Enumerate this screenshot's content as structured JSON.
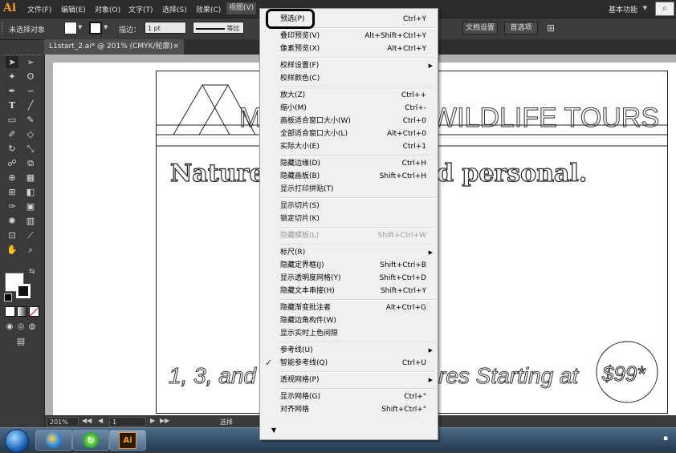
{
  "app": {
    "logo": "Ai",
    "menus": [
      "文件(F)",
      "编辑(E)",
      "对象(O)",
      "文字(T)",
      "选择(S)",
      "效果(C)",
      "视图(V)"
    ],
    "active_menu": "视图(V)",
    "workspace": "基本功能",
    "search_icon": "search-icon"
  },
  "control_bar": {
    "selection_status": "未选择对象",
    "stroke_label": "描边：",
    "stroke_value": "1 pt",
    "stroke_style": "等比",
    "doc_settings": "文档设置",
    "preferences": "首选项"
  },
  "document": {
    "tab_title": "L1start_2.ai* @ 201% (CMYK/轮廓)",
    "tab_close": "×"
  },
  "artwork": {
    "title_left": "M",
    "title_right": "WILDLIFE TOURS",
    "tagline_left": "Nature",
    "tagline_right": "d personal.",
    "bottom_left": "1, 3, and",
    "bottom_right": "res Starting at",
    "price": "$99*"
  },
  "status_bar": {
    "zoom": "201%",
    "page": "1",
    "mode": "选择"
  },
  "view_menu": {
    "items": [
      {
        "label": "预选(P)",
        "shortcut": "Ctrl+Y"
      },
      {
        "sep": true
      },
      {
        "label": "叠印预览(V)",
        "shortcut": "Alt+Shift+Ctrl+Y"
      },
      {
        "label": "像素预览(X)",
        "shortcut": "Alt+Ctrl+Y"
      },
      {
        "sep": true
      },
      {
        "label": "校样设置(F)",
        "shortcut": "",
        "submenu": true
      },
      {
        "label": "校样颜色(C)",
        "shortcut": ""
      },
      {
        "sep": true
      },
      {
        "label": "放大(Z)",
        "shortcut": "Ctrl++"
      },
      {
        "label": "缩小(M)",
        "shortcut": "Ctrl+-"
      },
      {
        "label": "画板适合窗口大小(W)",
        "shortcut": "Ctrl+0"
      },
      {
        "label": "全部适合窗口大小(L)",
        "shortcut": "Alt+Ctrl+0"
      },
      {
        "label": "实际大小(E)",
        "shortcut": "Ctrl+1"
      },
      {
        "sep": true
      },
      {
        "label": "隐藏边缘(D)",
        "shortcut": "Ctrl+H"
      },
      {
        "label": "隐藏画板(B)",
        "shortcut": "Shift+Ctrl+H"
      },
      {
        "label": "显示打印拼贴(T)",
        "shortcut": ""
      },
      {
        "sep": true
      },
      {
        "label": "显示切片(S)",
        "shortcut": ""
      },
      {
        "label": "锁定切片(K)",
        "shortcut": ""
      },
      {
        "sep": true
      },
      {
        "label": "隐藏模板(L)",
        "shortcut": "Shift+Ctrl+W",
        "disabled": true
      },
      {
        "sep": true
      },
      {
        "label": "标尺(R)",
        "shortcut": "",
        "submenu": true
      },
      {
        "label": "隐藏定界框(J)",
        "shortcut": "Shift+Ctrl+B"
      },
      {
        "label": "显示透明度网格(Y)",
        "shortcut": "Shift+Ctrl+D"
      },
      {
        "label": "隐藏文本串接(H)",
        "shortcut": "Shift+Ctrl+Y"
      },
      {
        "sep": true
      },
      {
        "label": "隐藏渐变批注者",
        "shortcut": "Alt+Ctrl+G"
      },
      {
        "label": "隐藏边角构件(W)",
        "shortcut": ""
      },
      {
        "label": "显示实时上色间隙",
        "shortcut": ""
      },
      {
        "sep": true
      },
      {
        "label": "参考线(U)",
        "shortcut": "",
        "submenu": true
      },
      {
        "label": "智能参考线(Q)",
        "shortcut": "Ctrl+U",
        "checked": true
      },
      {
        "sep": true
      },
      {
        "label": "透视网格(P)",
        "shortcut": "",
        "submenu": true
      },
      {
        "sep": true
      },
      {
        "label": "显示网格(G)",
        "shortcut": "Ctrl+\""
      },
      {
        "label": "对齐网格",
        "shortcut": "Shift+Ctrl+\""
      }
    ],
    "checkmark": "✓",
    "submenu_arrow": "▶",
    "more_arrow": "▼"
  }
}
